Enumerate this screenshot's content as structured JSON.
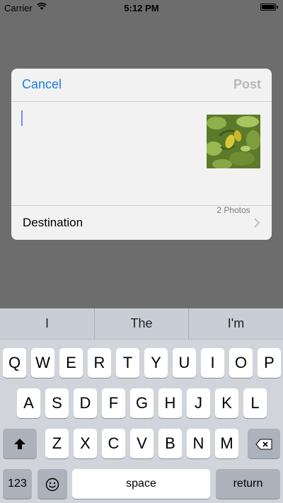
{
  "status_bar": {
    "carrier": "Carrier",
    "time": "5:12 PM",
    "battery_level": 1.0
  },
  "sheet": {
    "cancel_label": "Cancel",
    "post_label": "Post",
    "photo_count": "2 Photos",
    "destination_label": "Destination"
  },
  "keyboard": {
    "predictions": [
      "I",
      "The",
      "I'm"
    ],
    "row1": [
      "Q",
      "W",
      "E",
      "R",
      "T",
      "Y",
      "U",
      "I",
      "O",
      "P"
    ],
    "row2": [
      "A",
      "S",
      "D",
      "F",
      "G",
      "H",
      "J",
      "K",
      "L"
    ],
    "row3": [
      "Z",
      "X",
      "C",
      "V",
      "B",
      "N",
      "M"
    ],
    "numbers_label": "123",
    "space_label": "space",
    "return_label": "return"
  },
  "colors": {
    "accent": "#1a7ee8",
    "dimmed_background": "#6d6d6d",
    "keyboard_background": "#d1d5db"
  }
}
